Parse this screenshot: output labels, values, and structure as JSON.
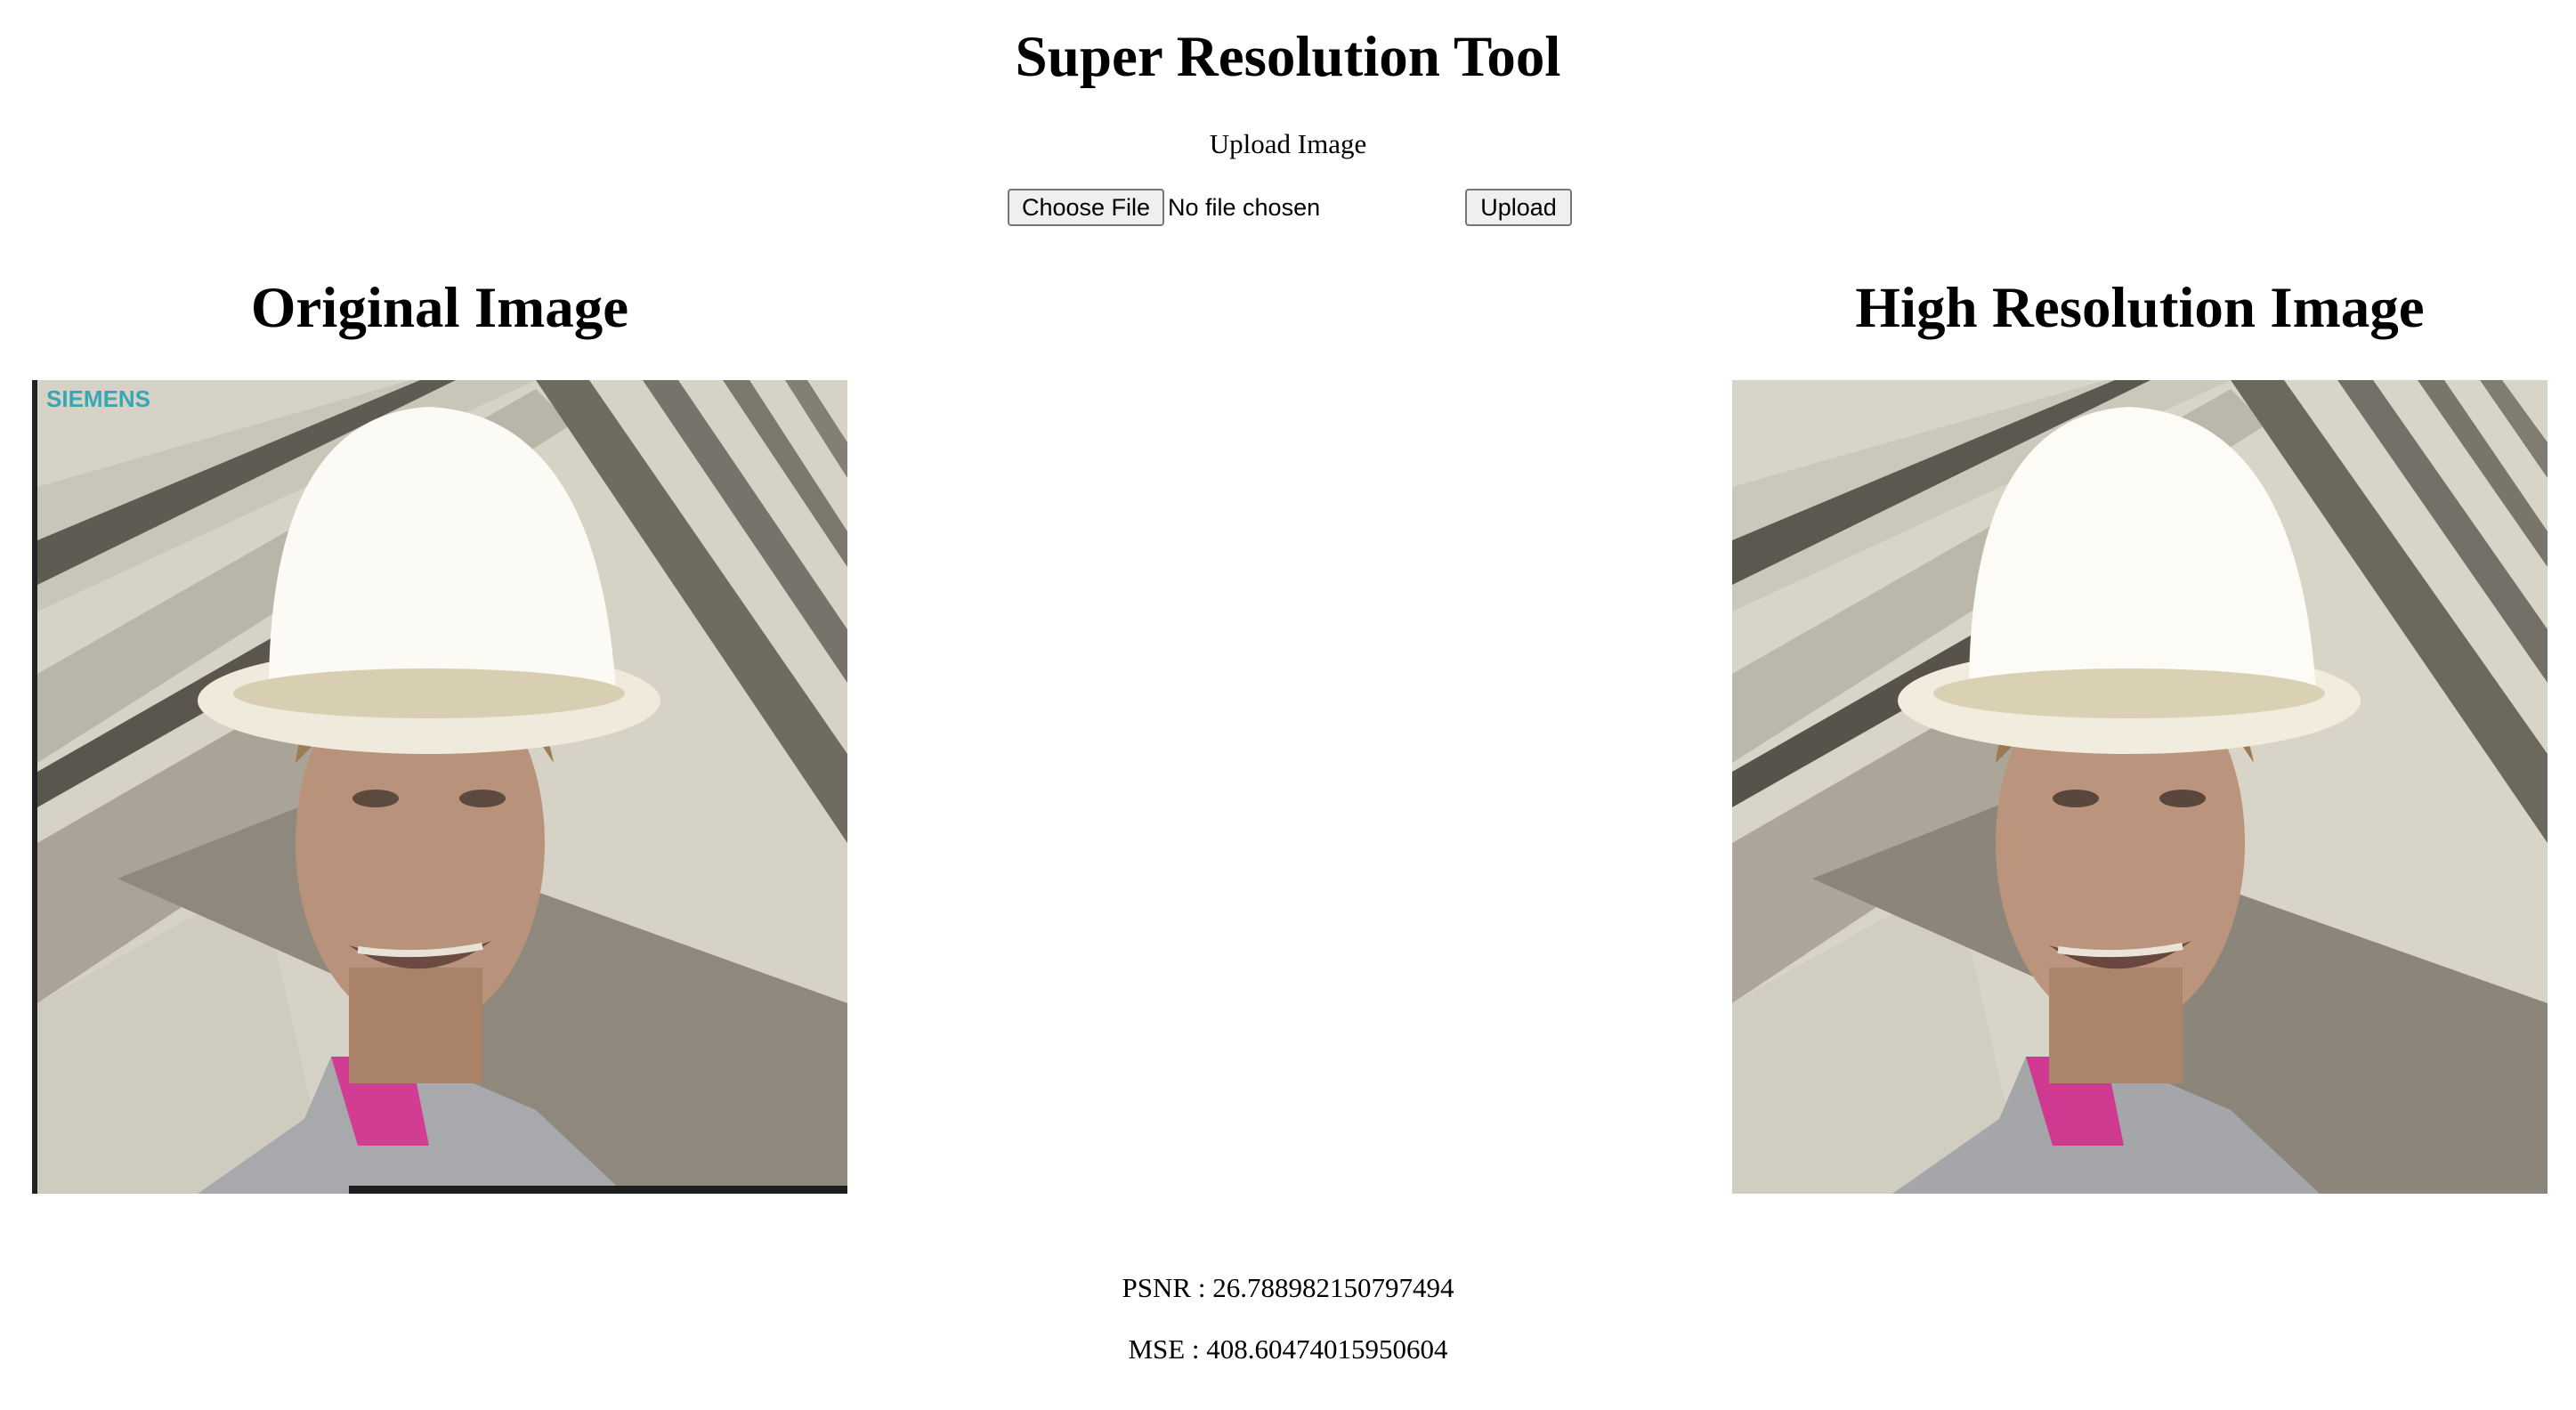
{
  "page": {
    "title": "Super Resolution Tool"
  },
  "upload": {
    "label": "Upload Image",
    "choose_button": "Choose File",
    "file_status": "No file chosen",
    "upload_button": "Upload"
  },
  "original": {
    "heading": "Original Image",
    "watermark": "SIEMENS"
  },
  "high_res": {
    "heading": "High Resolution Image"
  },
  "metrics": {
    "psnr": "PSNR : 26.788982150797494",
    "mse": "MSE : 408.60474015950604"
  }
}
